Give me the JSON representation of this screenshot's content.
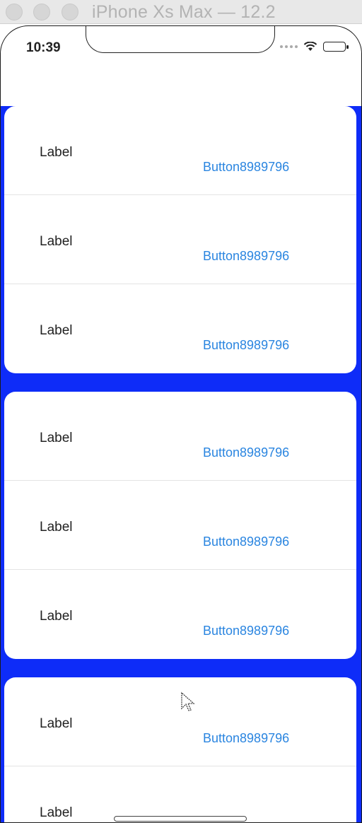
{
  "window": {
    "title": "iPhone Xs Max — 12.2"
  },
  "status_bar": {
    "time": "10:39",
    "icons": [
      "signal-dots-icon",
      "wifi-icon",
      "battery-icon"
    ]
  },
  "colors": {
    "background_blue": "#0e2cf8",
    "button_blue": "#2a85e0"
  },
  "sections": [
    {
      "rows": [
        {
          "label": "Label",
          "button": "Button8989796"
        },
        {
          "label": "Label",
          "button": "Button8989796"
        },
        {
          "label": "Label",
          "button": "Button8989796"
        }
      ]
    },
    {
      "rows": [
        {
          "label": "Label",
          "button": "Button8989796"
        },
        {
          "label": "Label",
          "button": "Button8989796"
        },
        {
          "label": "Label",
          "button": "Button8989796"
        }
      ]
    },
    {
      "rows": [
        {
          "label": "Label",
          "button": "Button8989796"
        },
        {
          "label": "Label",
          "button": ""
        }
      ]
    }
  ]
}
